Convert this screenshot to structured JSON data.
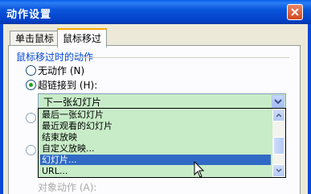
{
  "window": {
    "title": "动作设置"
  },
  "tabs": [
    {
      "label": "单击鼠标",
      "selected": false
    },
    {
      "label": "鼠标移过",
      "selected": true
    }
  ],
  "group": {
    "label": "鼠标移过时的动作"
  },
  "radios": [
    {
      "label": "无动作 (N)",
      "selected": false
    },
    {
      "label": "超链接到 (H):",
      "selected": true
    }
  ],
  "hyperlink_combo": {
    "value": "下一张幻灯片"
  },
  "dropdown_items": [
    {
      "label": "最后一张幻灯片",
      "selected": false
    },
    {
      "label": "最近观看的幻灯片",
      "selected": false
    },
    {
      "label": "结束放映",
      "selected": false
    },
    {
      "label": "自定义放映...",
      "selected": false
    },
    {
      "label": "幻灯片...",
      "selected": true
    },
    {
      "label": "URL...",
      "selected": false
    }
  ],
  "partially_hidden": {
    "label": "对象动作 (A):"
  },
  "colors": {
    "accent": "#316ac5",
    "titlebar": "#0a5ee8",
    "group_label": "#0046d5",
    "list_bg": "#c8ecc8"
  }
}
